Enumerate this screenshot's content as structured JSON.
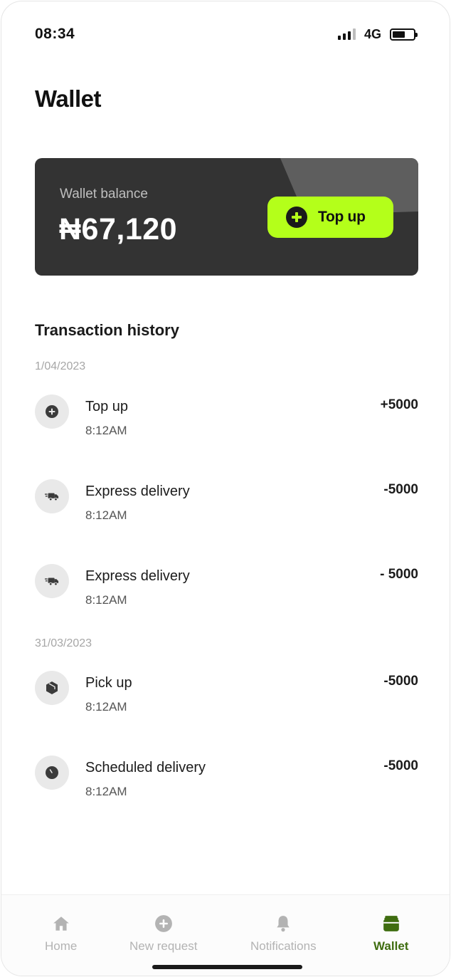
{
  "status_bar": {
    "time": "08:34",
    "network": "4G",
    "battery_level": 0.6
  },
  "page": {
    "title": "Wallet"
  },
  "balance_card": {
    "label": "Wallet balance",
    "amount": "₦67,120",
    "topup_label": "Top up",
    "topup_icon": "plus-circle-icon",
    "accent": "#b4ff1a",
    "card_color": "#333333"
  },
  "history": {
    "title": "Transaction history",
    "groups": [
      {
        "date": "1/04/2023",
        "transactions": [
          {
            "name": "Top up",
            "time": "8:12AM",
            "amount": "+5000",
            "icon": "plus-circle-icon"
          },
          {
            "name": "Express delivery",
            "time": "8:12AM",
            "amount": "-5000",
            "icon": "delivery-truck-icon"
          },
          {
            "name": "Express delivery",
            "time": "8:12AM",
            "amount": "- 5000",
            "icon": "delivery-truck-icon"
          }
        ]
      },
      {
        "date": "31/03/2023",
        "transactions": [
          {
            "name": "Pick up",
            "time": "8:12AM",
            "amount": "-5000",
            "icon": "package-icon"
          },
          {
            "name": "Scheduled delivery",
            "time": "8:12AM",
            "amount": "-5000",
            "icon": "clock-icon"
          }
        ]
      }
    ]
  },
  "bottom_nav": {
    "items": [
      {
        "label": "Home",
        "icon": "home-icon",
        "active": false
      },
      {
        "label": "New request",
        "icon": "plus-circle-icon",
        "active": false
      },
      {
        "label": "Notifications",
        "icon": "bell-icon",
        "active": false
      },
      {
        "label": "Wallet",
        "icon": "wallet-icon",
        "active": true
      }
    ],
    "active_color": "#3f6d10",
    "inactive_color": "#b3b3b3"
  }
}
